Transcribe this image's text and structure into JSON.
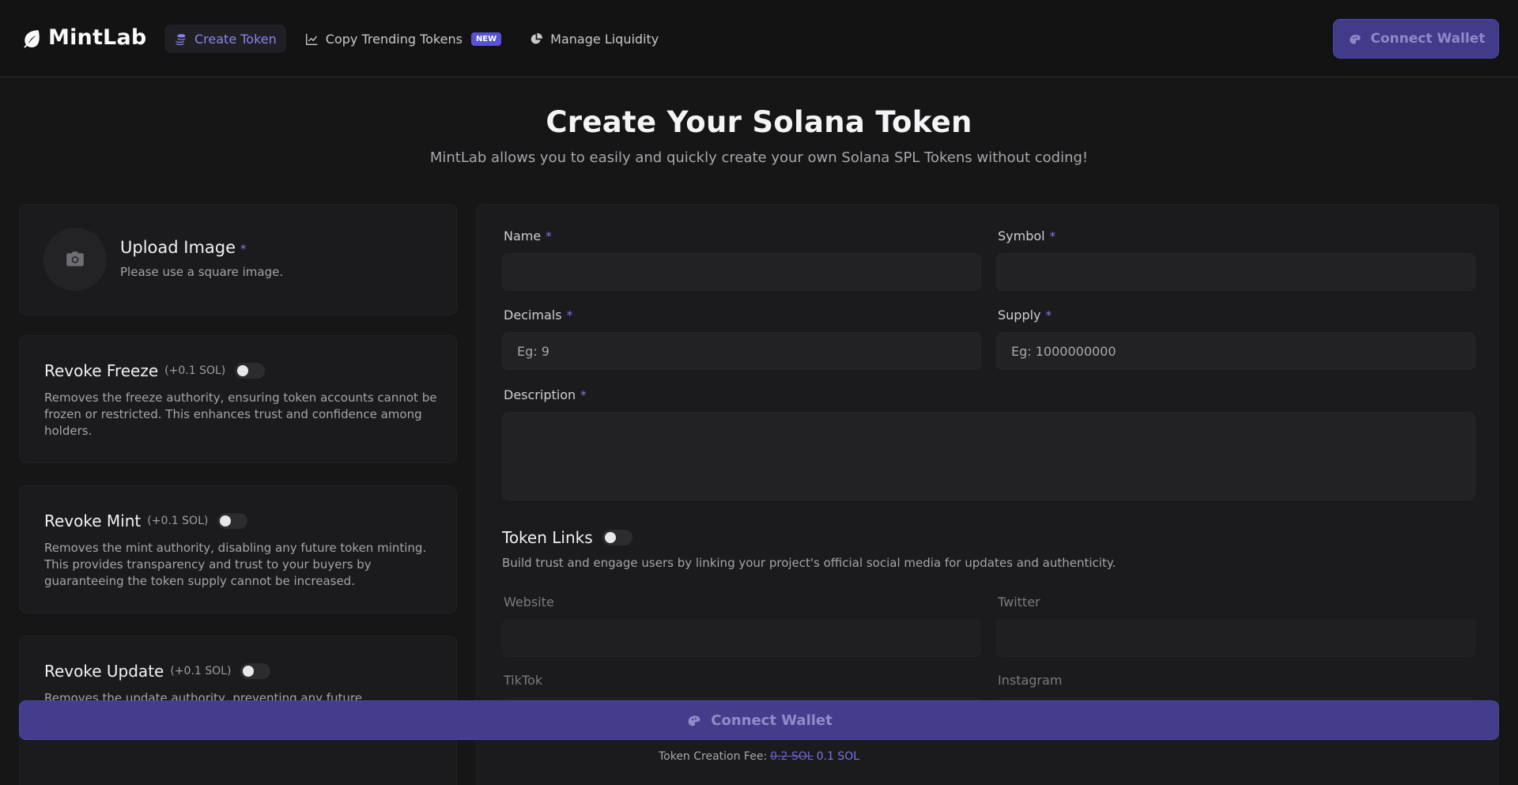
{
  "app": {
    "name": "MintLab"
  },
  "nav": {
    "items": [
      {
        "label": "Create Token",
        "icon": "coins-icon",
        "active": true
      },
      {
        "label": "Copy Trending Tokens",
        "icon": "trending-chart-icon",
        "badge": "NEW"
      },
      {
        "label": "Manage Liquidity",
        "icon": "pie-chart-icon"
      }
    ]
  },
  "header": {
    "connect_label": "Connect Wallet"
  },
  "hero": {
    "title": "Create Your Solana Token",
    "subtitle": "MintLab allows you to easily and quickly create your own Solana SPL Tokens without coding!"
  },
  "upload": {
    "title": "Upload Image",
    "required": "*",
    "hint": "Please use a square image."
  },
  "options": [
    {
      "title": "Revoke Freeze",
      "fee": "(+0.1 SOL)",
      "enabled": false,
      "desc": "Removes the freeze authority, ensuring token accounts cannot be frozen or restricted. This enhances trust and confidence among holders."
    },
    {
      "title": "Revoke Mint",
      "fee": "(+0.1 SOL)",
      "enabled": false,
      "desc": "Removes the mint authority, disabling any future token minting. This provides transparency and trust to your buyers by guaranteeing the token supply cannot be increased."
    },
    {
      "title": "Revoke Update",
      "fee": "(+0.1 SOL)",
      "enabled": false,
      "desc": "Removes the update authority, preventing any future modifications to the token metadata. This ensures the token's identity and details cannot be altered."
    }
  ],
  "form": {
    "name_label": "Name",
    "symbol_label": "Symbol",
    "decimals_label": "Decimals",
    "decimals_placeholder": "Eg: 9",
    "supply_label": "Supply",
    "supply_placeholder": "Eg: 1000000000",
    "description_label": "Description",
    "required": "*"
  },
  "links": {
    "title": "Token Links",
    "enabled": false,
    "desc": "Build trust and engage users by linking your project's official social media for updates and authenticity.",
    "website_label": "Website",
    "twitter_label": "Twitter",
    "tiktok_label": "TikTok",
    "instagram_label": "Instagram"
  },
  "footer": {
    "connect_label": "Connect Wallet",
    "fee_label": "Token Creation Fee:",
    "fee_old": "0.2 SOL",
    "fee_new": "0.1 SOL"
  },
  "colors": {
    "accent": "#7f78e6",
    "button_bg": "#433d8c",
    "page_bg": "#161616"
  }
}
